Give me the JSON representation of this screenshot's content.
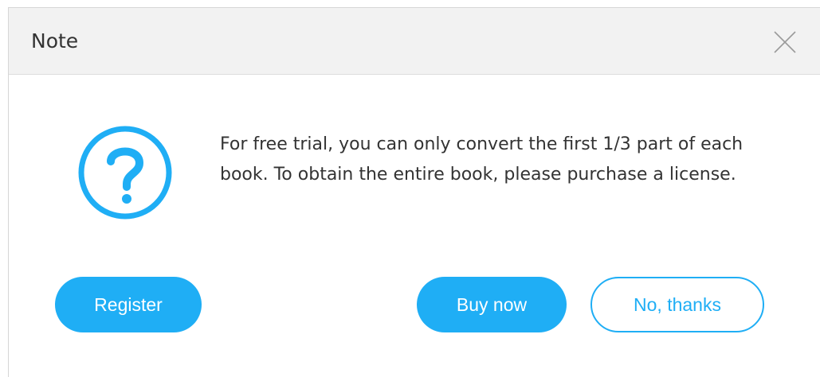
{
  "dialog": {
    "title": "Note",
    "close_icon": "close-icon",
    "status_icon": "question-circle-icon",
    "message": "For free trial, you can only convert the first 1/3 part of each book. To obtain the entire book, please purchase a license."
  },
  "buttons": {
    "register": "Register",
    "buy_now": "Buy now",
    "no_thanks": "No, thanks"
  },
  "colors": {
    "accent": "#1faef5",
    "titlebar": "#f2f2f2",
    "text": "#333333"
  }
}
